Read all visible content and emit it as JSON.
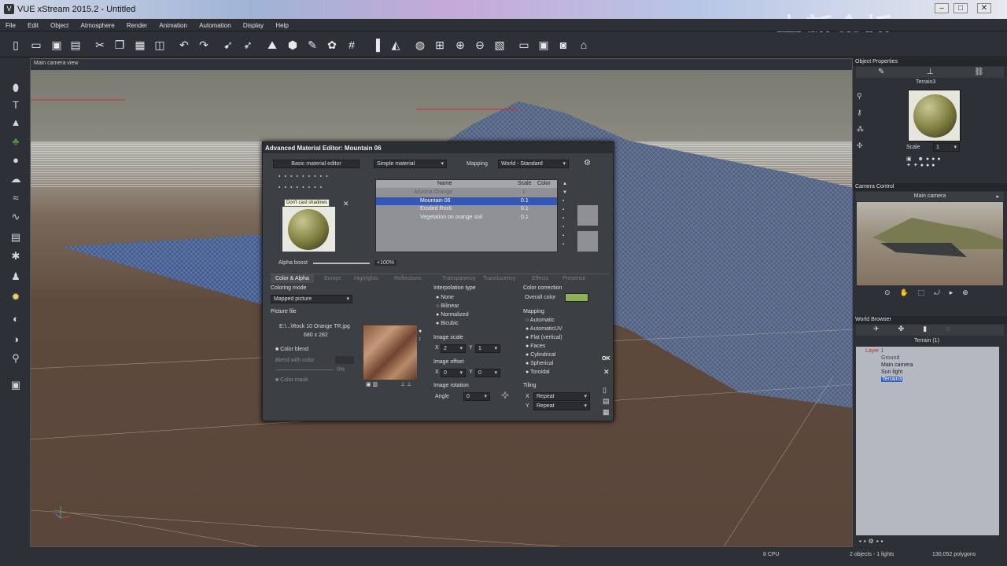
{
  "window": {
    "title": "VUE xStream 2015.2 - Untitled",
    "app_icon": "vue-icon",
    "controls": [
      "minimize",
      "maximize",
      "close"
    ]
  },
  "watermark": "中新金桥",
  "menu": [
    "File",
    "Edit",
    "Object",
    "Atmosphere",
    "Render",
    "Animation",
    "Automation",
    "Display",
    "Help"
  ],
  "toolbar_icons": [
    "new-icon",
    "open-icon",
    "save-icon",
    "save-as-icon",
    "cut-icon",
    "copy-icon",
    "paste-icon",
    "duplicate-icon",
    "undo-icon",
    "redo-icon",
    "select-icon",
    "pointer-icon",
    "terrain-icon",
    "object-icon",
    "paint-icon",
    "material-icon",
    "grid-icon",
    "align-icon",
    "mirror-icon",
    "globe-icon",
    "snap-icon",
    "zoom-in-icon",
    "zoom-out-icon",
    "frame-icon",
    "render-area-icon",
    "render-icon",
    "screenshot-icon"
  ],
  "viewport": {
    "title": "Main camera view"
  },
  "object_properties": {
    "header": "Object Properties",
    "object_name": "Terrain3",
    "scale_label": "Scale",
    "scale_value": "1"
  },
  "camera_control": {
    "header": "Camera Control",
    "camera": "Main camera"
  },
  "world_browser": {
    "header": "World Browser",
    "tab": "Terrain (1)",
    "items": [
      "Layer 1",
      "Ground",
      "Main camera",
      "Sun light",
      "Terrain3"
    ]
  },
  "status": {
    "cpu": "8 CPU",
    "objects": "2 objects - 1 lights",
    "polygons": "130,052 polygons"
  },
  "material_editor": {
    "title": "Advanced Material Editor: Mountain 06",
    "basic_button": "Basic material editor",
    "material_type": "Simple material",
    "mapping_label": "Mapping",
    "mapping_value": "World - Standard",
    "tooltip": "Don't cast shadows",
    "list_headers": [
      "Name",
      "Scale",
      "Color"
    ],
    "layers": [
      {
        "name": "Arizona Orange",
        "scale": "1"
      },
      {
        "name": "Mountain 06",
        "scale": "0.1"
      },
      {
        "name": "Eroded Rock",
        "scale": "0.1"
      },
      {
        "name": "Vegetation on orange soil",
        "scale": "0.1"
      }
    ],
    "alpha_boost_label": "Alpha boost",
    "alpha_boost_value": "+100%",
    "tabs": [
      "Color & Alpha",
      "Bumps",
      "Highlights",
      "Reflections",
      "Transparency",
      "Translucency",
      "Effects",
      "Presence"
    ],
    "coloring_mode_label": "Coloring mode",
    "coloring_mode": "Mapped picture",
    "picture_file_label": "Picture file",
    "picture_file": "E:\\...\\Rock 10 Orange TR.jpg",
    "picture_size": "680 x 282",
    "color_blend_label": "Color blend",
    "blend_with_color": "Blend with color",
    "blend_pct": "0%",
    "color_mask": "Color mask",
    "interp_label": "Interpolation type",
    "interp_options": [
      "None",
      "Bilinear",
      "Normalized",
      "Bicubic"
    ],
    "image_scale_label": "Image scale",
    "scale_x": "2",
    "scale_y": "1",
    "image_offset_label": "Image offset",
    "offset_x": "0",
    "offset_y": "0",
    "image_rotation_label": "Image rotation",
    "angle_label": "Angle",
    "angle": "0",
    "color_correction_label": "Color correction",
    "overall_color": "Overall color",
    "mapping2_label": "Mapping",
    "mapping_options": [
      "Automatic",
      "AutomaticUV",
      "Flat (vertical)",
      "Faces",
      "Cylindrical",
      "Spherical",
      "Toroidal"
    ],
    "tiling_label": "Tiling",
    "tiling_x": "Repeat",
    "tiling_y": "Repeat",
    "ok": "OK",
    "x_label": "X",
    "y_label": "Y"
  }
}
